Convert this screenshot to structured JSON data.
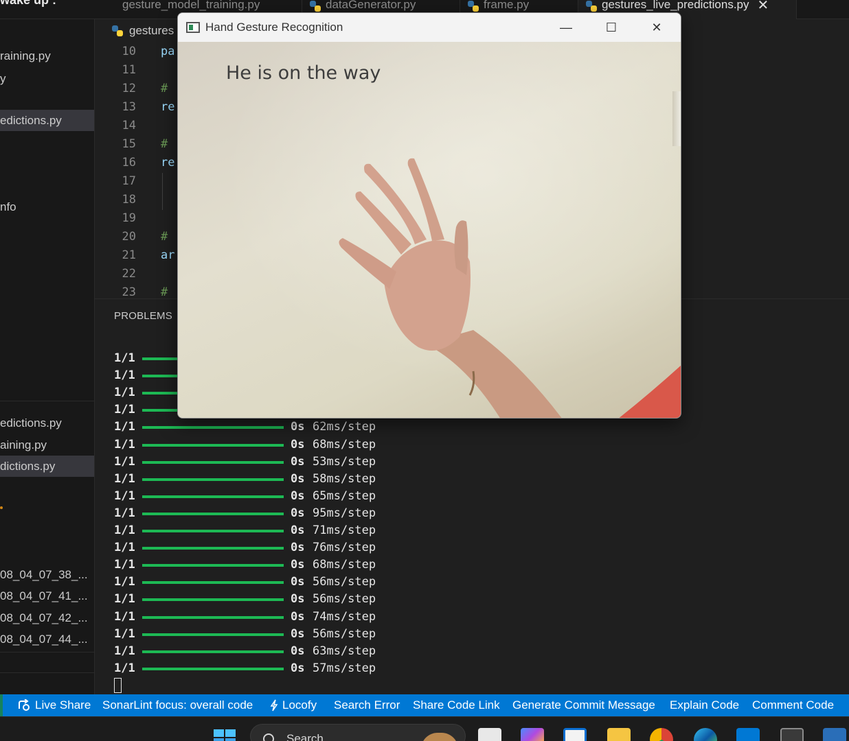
{
  "sidebar_header": "wake up :",
  "tabs": [
    {
      "label": "gesture_model_training.py",
      "active": false
    },
    {
      "label": "dataGenerator.py",
      "active": false
    },
    {
      "label": "frame.py",
      "active": false
    },
    {
      "label": "gestures_live_predictions.py",
      "active": true
    }
  ],
  "tab_close_glyph": "✕",
  "breadcrumb": "gestures",
  "explorer_items": [
    {
      "label": "raining.py",
      "selected": false
    },
    {
      "label": "y",
      "selected": false
    },
    {
      "label": "edictions.py",
      "selected": true
    },
    {
      "label": "nfo",
      "selected": false
    },
    {
      "label": "edictions.py",
      "selected": false
    },
    {
      "label": "aining.py",
      "selected": false
    },
    {
      "label": "dictions.py",
      "selected": true
    },
    {
      "label": "08_04_07_38_...",
      "selected": false
    },
    {
      "label": "08_04_07_41_...",
      "selected": false
    },
    {
      "label": "08_04_07_42_...",
      "selected": false
    },
    {
      "label": "08_04_07_44_...",
      "selected": false
    }
  ],
  "code_lines": [
    {
      "num": "10",
      "text": "pa",
      "kind": "code"
    },
    {
      "num": "11",
      "text": "",
      "kind": "code"
    },
    {
      "num": "12",
      "text": "#",
      "kind": "comment"
    },
    {
      "num": "13",
      "text": "re",
      "kind": "code"
    },
    {
      "num": "14",
      "text": "",
      "kind": "code"
    },
    {
      "num": "15",
      "text": "#",
      "kind": "comment"
    },
    {
      "num": "16",
      "text": "re",
      "kind": "code"
    },
    {
      "num": "17",
      "text": "",
      "kind": "code"
    },
    {
      "num": "18",
      "text": "",
      "kind": "code"
    },
    {
      "num": "19",
      "text": "",
      "kind": "code"
    },
    {
      "num": "20",
      "text": "#",
      "kind": "comment"
    },
    {
      "num": "21",
      "text": "ar",
      "kind": "code"
    },
    {
      "num": "22",
      "text": "",
      "kind": "code"
    },
    {
      "num": "23",
      "text": "#",
      "kind": "comment"
    }
  ],
  "panel_tab": "PROBLEMS",
  "terminal_rows": [
    {
      "step": "1/1",
      "time": "",
      "rate": ""
    },
    {
      "step": "1/1",
      "time": "",
      "rate": ""
    },
    {
      "step": "1/1",
      "time": "",
      "rate": ""
    },
    {
      "step": "1/1",
      "time": "",
      "rate": ""
    },
    {
      "step": "1/1",
      "time": "0s",
      "rate": "62ms/step"
    },
    {
      "step": "1/1",
      "time": "0s",
      "rate": "68ms/step"
    },
    {
      "step": "1/1",
      "time": "0s",
      "rate": "53ms/step"
    },
    {
      "step": "1/1",
      "time": "0s",
      "rate": "58ms/step"
    },
    {
      "step": "1/1",
      "time": "0s",
      "rate": "65ms/step"
    },
    {
      "step": "1/1",
      "time": "0s",
      "rate": "95ms/step"
    },
    {
      "step": "1/1",
      "time": "0s",
      "rate": "71ms/step"
    },
    {
      "step": "1/1",
      "time": "0s",
      "rate": "76ms/step"
    },
    {
      "step": "1/1",
      "time": "0s",
      "rate": "68ms/step"
    },
    {
      "step": "1/1",
      "time": "0s",
      "rate": "56ms/step"
    },
    {
      "step": "1/1",
      "time": "0s",
      "rate": "56ms/step"
    },
    {
      "step": "1/1",
      "time": "0s",
      "rate": "74ms/step"
    },
    {
      "step": "1/1",
      "time": "0s",
      "rate": "56ms/step"
    },
    {
      "step": "1/1",
      "time": "0s",
      "rate": "63ms/step"
    },
    {
      "step": "1/1",
      "time": "0s",
      "rate": "57ms/step"
    }
  ],
  "status_items": [
    {
      "label": "Live Share",
      "icon": "live-share-icon"
    },
    {
      "label": "SonarLint focus: overall code",
      "icon": ""
    },
    {
      "label": "Locofy",
      "icon": "bolt-icon"
    },
    {
      "label": "Search Error",
      "icon": ""
    },
    {
      "label": "Share Code Link",
      "icon": ""
    },
    {
      "label": "Generate Commit Message",
      "icon": ""
    },
    {
      "label": "Explain Code",
      "icon": ""
    },
    {
      "label": "Comment Code",
      "icon": ""
    }
  ],
  "taskbar": {
    "search_placeholder": "Search",
    "apps": [
      "start-icon",
      "files-app-icon",
      "copilot-icon",
      "store-icon",
      "file-explorer-icon",
      "chrome-icon",
      "edge-icon",
      "vscode-icon",
      "terminal-icon",
      "remote-desktop-icon"
    ]
  },
  "popup_window": {
    "title": "Hand Gesture Recognition",
    "controls": {
      "minimize": "—",
      "maximize": "☐",
      "close": "✕"
    },
    "prediction_text": "He is on the way"
  },
  "colors": {
    "status_bar": "#0078d4",
    "progress_bar": "#1db954",
    "editor_bg": "#1f1f1f",
    "sidebar_bg": "#181818"
  }
}
